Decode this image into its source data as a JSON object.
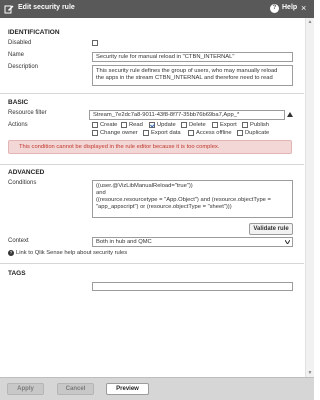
{
  "window": {
    "title": "Edit security rule",
    "help_label": "Help"
  },
  "identification": {
    "heading": "IDENTIFICATION",
    "disabled_label": "Disabled",
    "name_label": "Name",
    "name_value": "Security rule for manual reload in \"CTBN_INTERNAL\"",
    "description_label": "Description",
    "description_line1": "This security rule defines the group of users, who may manually reload",
    "description_line2": "the apps in the stream CTBN_INTERNAL and therefore need to read"
  },
  "basic": {
    "heading": "BASIC",
    "resource_filter_label": "Resource filter",
    "resource_filter_value": "Stream_7e2dc7a8-9011-43f8-8f77-35bb76b69ba7,App_*",
    "actions_label": "Actions",
    "actions": [
      {
        "label": "Create",
        "checked": false
      },
      {
        "label": "Read",
        "checked": false
      },
      {
        "label": "Update",
        "checked": true
      },
      {
        "label": "Delete",
        "checked": false
      },
      {
        "label": "Export",
        "checked": false
      },
      {
        "label": "Publish",
        "checked": false
      },
      {
        "label": "Change owner",
        "checked": false
      },
      {
        "label": "Export data",
        "checked": false
      },
      {
        "label": "Access offline",
        "checked": false
      },
      {
        "label": "Duplicate",
        "checked": false
      }
    ],
    "warning": "This condition cannot be displayed in the rule editor because it is too complex."
  },
  "advanced": {
    "heading": "ADVANCED",
    "conditions_label": "Conditions",
    "conditions_lines": [
      "((user.@VizLibManualReload=\"true\"))",
      "and",
      "((resource.resourcetype = \"App.Object\") and (resource.objectType =",
      "\"app_appscript\") or (resource.objectType = \"sheet\")))"
    ],
    "validate_label": "Validate rule",
    "context_label": "Context",
    "context_value": "Both in hub and QMC",
    "help_link": "Link to Qlik Sense help about security rules"
  },
  "tags": {
    "heading": "TAGS",
    "value": ""
  },
  "footer": {
    "apply": "Apply",
    "cancel": "Cancel",
    "preview": "Preview"
  }
}
